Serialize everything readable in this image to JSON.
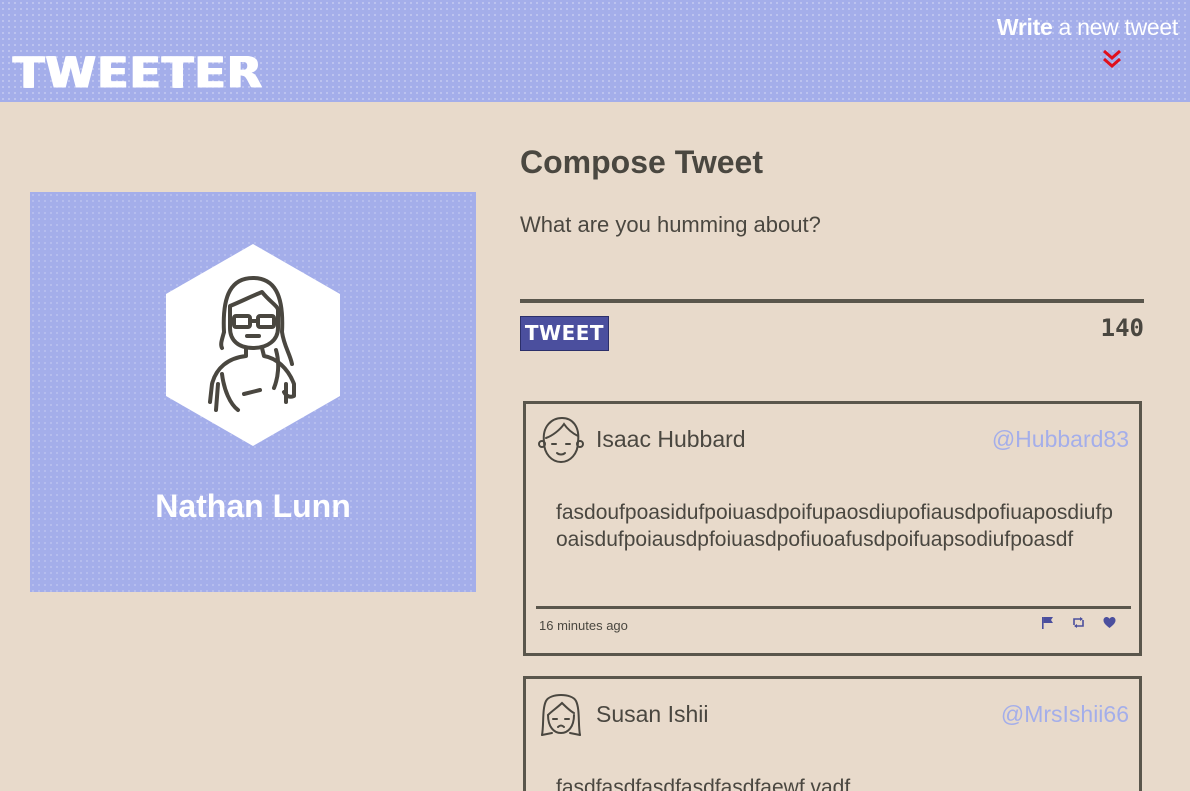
{
  "nav": {
    "brand": "TWEETER",
    "write_bold": "Write",
    "write_rest": " a new tweet",
    "chevron_color": "#e0101c"
  },
  "profile": {
    "name": "Nathan Lunn",
    "avatar_icon": "woman-avatar-icon"
  },
  "compose": {
    "title": "Compose Tweet",
    "placeholder": "What are you humming about?",
    "button_label": "TWEET",
    "counter": "140"
  },
  "tweets": [
    {
      "name": "Isaac Hubbard",
      "handle": "@Hubbard83",
      "body": "fasdoufpoasidufpoiuasdpoifupaosdiupofiausdpofiuaposdiufpoaisdufpoiausdpfoiuasdpofiuoafusdpoifuapsodiufpoasdf",
      "time": "16 minutes ago",
      "avatar_icon": "man-avatar-icon"
    },
    {
      "name": "Susan Ishii",
      "handle": "@MrsIshii66",
      "body": "fasdfasdfasdfasdfasdfaewf vadf",
      "avatar_icon": "woman-avatar-icon"
    }
  ],
  "colors": {
    "background": "#e8dacb",
    "accent": "#a4aeea",
    "button": "#4b4f9e",
    "text": "#4a4740"
  }
}
